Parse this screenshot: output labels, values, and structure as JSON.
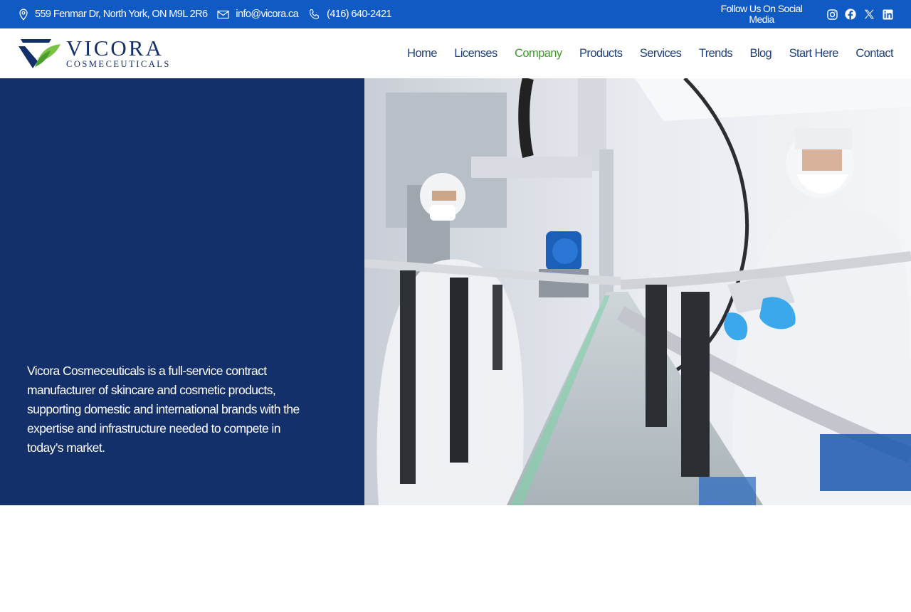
{
  "topbar": {
    "address": "559 Fenmar Dr, North York, ON M9L 2R6",
    "email": "info@vicora.ca",
    "phone": "(416) 640-2421",
    "follow_label": "Follow Us On Social Media",
    "social_icons": [
      "instagram-icon",
      "facebook-icon",
      "x-icon",
      "linkedin-icon"
    ]
  },
  "header": {
    "brand_name": "VICORA",
    "brand_sub": "COSMECEUTICALS",
    "nav": [
      {
        "label": "Home"
      },
      {
        "label": "Licenses"
      },
      {
        "label": "Company",
        "active": true
      },
      {
        "label": "Products"
      },
      {
        "label": "Services"
      },
      {
        "label": "Trends"
      },
      {
        "label": "Blog"
      },
      {
        "label": "Start Here"
      },
      {
        "label": "Contact"
      }
    ]
  },
  "hero": {
    "text": "Vicora Cosmeceuticals is a full-service contract manufacturer of skincare and cosmetic products, supporting domestic and international brands with the expertise and infrastructure needed to compete in today’s market."
  },
  "colors": {
    "topbar_bg": "#105ac4",
    "navy": "#14306b",
    "nav_text": "#1f3f7a",
    "nav_active": "#3f9b2a",
    "leaf_green": "#7cc242"
  }
}
